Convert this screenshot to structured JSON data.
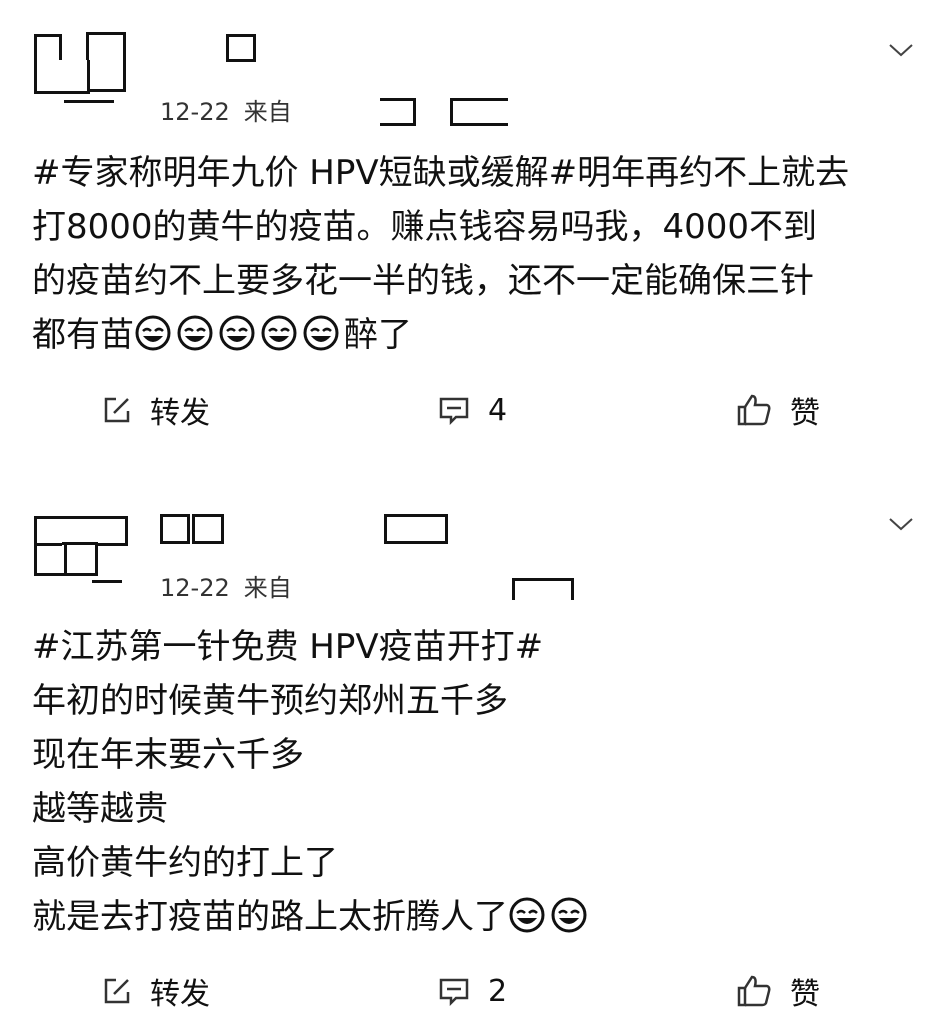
{
  "posts": [
    {
      "date": "12-22",
      "source_prefix": "来自",
      "content_lines": [
        "#专家称明年九价 HPV短缺或缓解#明年再约不上就去",
        "打8000的黄牛的疫苗。赚点钱容易吗我，4000不到",
        "的疫苗约不上要多花一半的钱，还不一定能确保三针",
        "都有苗"
      ],
      "trailing_text": "醉了",
      "emoji_count": 5,
      "emoji_icon": "laugh-cry-icon",
      "actions": {
        "repost": "转发",
        "comments": "4",
        "like": "赞"
      }
    },
    {
      "date": "12-22",
      "source_prefix": "来自",
      "content_lines": [
        "#江苏第一针免费 HPV疫苗开打#",
        "年初的时候黄牛预约郑州五千多",
        "现在年末要六千多",
        "越等越贵",
        "高价黄牛约的打上了",
        "就是去打疫苗的路上太折腾人了"
      ],
      "emoji_count": 2,
      "emoji_icon": "laugh-cry-icon",
      "actions": {
        "repost": "转发",
        "comments": "2",
        "like": "赞"
      }
    }
  ]
}
